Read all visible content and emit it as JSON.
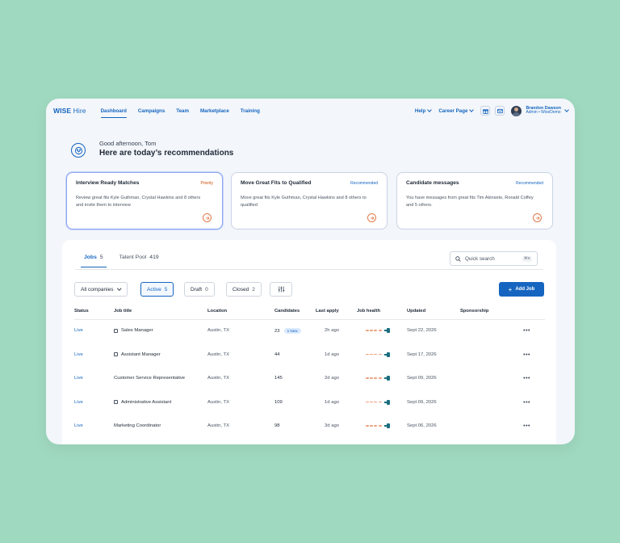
{
  "app": {
    "logo_bold": "WISE",
    "logo_light": "Hire"
  },
  "nav": {
    "tabs": [
      {
        "label": "Dashboard",
        "active": true
      },
      {
        "label": "Campaigns"
      },
      {
        "label": "Team"
      },
      {
        "label": "Marketplace"
      },
      {
        "label": "Training"
      }
    ],
    "help": "Help",
    "career_page": "Career Page",
    "user": {
      "name": "Brandon Dawson",
      "role": "Admin • WiseDemo"
    }
  },
  "greeting": {
    "hello": "Good afternoon, Tom",
    "headline": "Here are today’s recommendations"
  },
  "recommendations": [
    {
      "title": "Interview Ready Matches",
      "tag": "Priority",
      "body": "Review  great fits Kyle Guthman, Crystal Hawkins and 8 others and invite them to interview"
    },
    {
      "title": "Move Great Fits to Qualified",
      "tag": "Recommended",
      "body": "Move  great fits Kyle Guthman, Crystal Hawkins and 8 others to qualified"
    },
    {
      "title": "Candidate messages",
      "tag": "Recommended",
      "body": "You have messages from great fits Tim Akinsete, Ronald Coffey and 5 others."
    }
  ],
  "jobs_panel": {
    "tabs": [
      {
        "label": "Jobs",
        "count": "5"
      },
      {
        "label": "Talent Pool",
        "count": "419"
      }
    ],
    "search": {
      "placeholder": "Quick search",
      "shortcut": "⌘K"
    },
    "filters": {
      "company": "All companies",
      "active": {
        "label": "Active",
        "count": "5"
      },
      "draft": {
        "label": "Draft",
        "count": "0"
      },
      "closed": {
        "label": "Closed",
        "count": "2"
      }
    },
    "add_job": "Add Job",
    "columns": [
      "Status",
      "Job title",
      "Location",
      "Candidates",
      "Last apply",
      "Job health",
      "Updated",
      "Sponsorship"
    ],
    "rows": [
      {
        "status": "Live",
        "title": "Sales Manager",
        "location": "Austin, TX",
        "candidates": "23",
        "badge": "1 New",
        "last_apply": "2h ago",
        "updated": "Sept 22, 2026"
      },
      {
        "status": "Live",
        "title": "Assistant Manager",
        "location": "Austin, TX",
        "candidates": "44",
        "badge": "",
        "last_apply": "1d ago",
        "updated": "Sept 17, 2026"
      },
      {
        "status": "Live",
        "title": "Customer Service Representative",
        "location": "Austin, TX",
        "candidates": "145",
        "badge": "",
        "last_apply": "2d ago",
        "updated": "Sept 09, 2026"
      },
      {
        "status": "Live",
        "title": "Administrative Assistant",
        "location": "Austin, TX",
        "candidates": "109",
        "badge": "",
        "last_apply": "1d ago",
        "updated": "Sept 09, 2026"
      },
      {
        "status": "Live",
        "title": "Marketing Coordinator",
        "location": "Austin, TX",
        "candidates": "98",
        "badge": "",
        "last_apply": "3d ago",
        "updated": "Sept 06, 2026"
      }
    ],
    "more_menu": "•••"
  },
  "colors": {
    "brand": "#1565c0",
    "background": "#9fd9bf",
    "priority": "#d0500a"
  }
}
